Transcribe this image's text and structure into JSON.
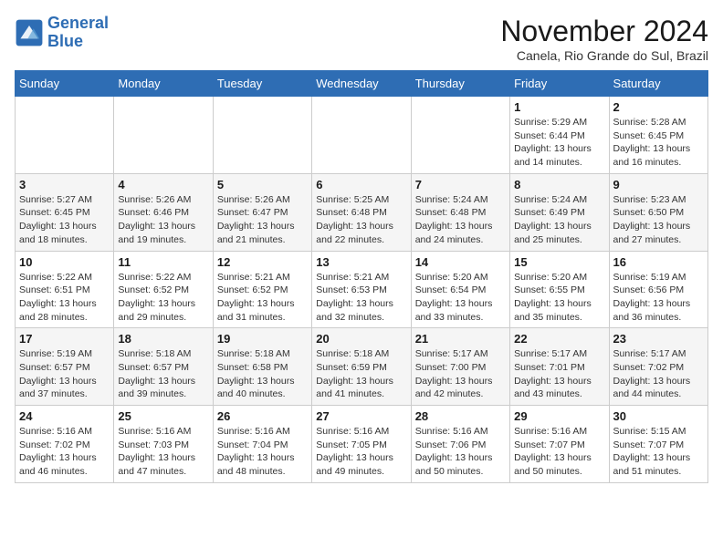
{
  "logo": {
    "line1": "General",
    "line2": "Blue"
  },
  "title": "November 2024",
  "location": "Canela, Rio Grande do Sul, Brazil",
  "days_header": [
    "Sunday",
    "Monday",
    "Tuesday",
    "Wednesday",
    "Thursday",
    "Friday",
    "Saturday"
  ],
  "weeks": [
    [
      {
        "day": "",
        "text": ""
      },
      {
        "day": "",
        "text": ""
      },
      {
        "day": "",
        "text": ""
      },
      {
        "day": "",
        "text": ""
      },
      {
        "day": "",
        "text": ""
      },
      {
        "day": "1",
        "text": "Sunrise: 5:29 AM\nSunset: 6:44 PM\nDaylight: 13 hours and 14 minutes."
      },
      {
        "day": "2",
        "text": "Sunrise: 5:28 AM\nSunset: 6:45 PM\nDaylight: 13 hours and 16 minutes."
      }
    ],
    [
      {
        "day": "3",
        "text": "Sunrise: 5:27 AM\nSunset: 6:45 PM\nDaylight: 13 hours and 18 minutes."
      },
      {
        "day": "4",
        "text": "Sunrise: 5:26 AM\nSunset: 6:46 PM\nDaylight: 13 hours and 19 minutes."
      },
      {
        "day": "5",
        "text": "Sunrise: 5:26 AM\nSunset: 6:47 PM\nDaylight: 13 hours and 21 minutes."
      },
      {
        "day": "6",
        "text": "Sunrise: 5:25 AM\nSunset: 6:48 PM\nDaylight: 13 hours and 22 minutes."
      },
      {
        "day": "7",
        "text": "Sunrise: 5:24 AM\nSunset: 6:48 PM\nDaylight: 13 hours and 24 minutes."
      },
      {
        "day": "8",
        "text": "Sunrise: 5:24 AM\nSunset: 6:49 PM\nDaylight: 13 hours and 25 minutes."
      },
      {
        "day": "9",
        "text": "Sunrise: 5:23 AM\nSunset: 6:50 PM\nDaylight: 13 hours and 27 minutes."
      }
    ],
    [
      {
        "day": "10",
        "text": "Sunrise: 5:22 AM\nSunset: 6:51 PM\nDaylight: 13 hours and 28 minutes."
      },
      {
        "day": "11",
        "text": "Sunrise: 5:22 AM\nSunset: 6:52 PM\nDaylight: 13 hours and 29 minutes."
      },
      {
        "day": "12",
        "text": "Sunrise: 5:21 AM\nSunset: 6:52 PM\nDaylight: 13 hours and 31 minutes."
      },
      {
        "day": "13",
        "text": "Sunrise: 5:21 AM\nSunset: 6:53 PM\nDaylight: 13 hours and 32 minutes."
      },
      {
        "day": "14",
        "text": "Sunrise: 5:20 AM\nSunset: 6:54 PM\nDaylight: 13 hours and 33 minutes."
      },
      {
        "day": "15",
        "text": "Sunrise: 5:20 AM\nSunset: 6:55 PM\nDaylight: 13 hours and 35 minutes."
      },
      {
        "day": "16",
        "text": "Sunrise: 5:19 AM\nSunset: 6:56 PM\nDaylight: 13 hours and 36 minutes."
      }
    ],
    [
      {
        "day": "17",
        "text": "Sunrise: 5:19 AM\nSunset: 6:57 PM\nDaylight: 13 hours and 37 minutes."
      },
      {
        "day": "18",
        "text": "Sunrise: 5:18 AM\nSunset: 6:57 PM\nDaylight: 13 hours and 39 minutes."
      },
      {
        "day": "19",
        "text": "Sunrise: 5:18 AM\nSunset: 6:58 PM\nDaylight: 13 hours and 40 minutes."
      },
      {
        "day": "20",
        "text": "Sunrise: 5:18 AM\nSunset: 6:59 PM\nDaylight: 13 hours and 41 minutes."
      },
      {
        "day": "21",
        "text": "Sunrise: 5:17 AM\nSunset: 7:00 PM\nDaylight: 13 hours and 42 minutes."
      },
      {
        "day": "22",
        "text": "Sunrise: 5:17 AM\nSunset: 7:01 PM\nDaylight: 13 hours and 43 minutes."
      },
      {
        "day": "23",
        "text": "Sunrise: 5:17 AM\nSunset: 7:02 PM\nDaylight: 13 hours and 44 minutes."
      }
    ],
    [
      {
        "day": "24",
        "text": "Sunrise: 5:16 AM\nSunset: 7:02 PM\nDaylight: 13 hours and 46 minutes."
      },
      {
        "day": "25",
        "text": "Sunrise: 5:16 AM\nSunset: 7:03 PM\nDaylight: 13 hours and 47 minutes."
      },
      {
        "day": "26",
        "text": "Sunrise: 5:16 AM\nSunset: 7:04 PM\nDaylight: 13 hours and 48 minutes."
      },
      {
        "day": "27",
        "text": "Sunrise: 5:16 AM\nSunset: 7:05 PM\nDaylight: 13 hours and 49 minutes."
      },
      {
        "day": "28",
        "text": "Sunrise: 5:16 AM\nSunset: 7:06 PM\nDaylight: 13 hours and 50 minutes."
      },
      {
        "day": "29",
        "text": "Sunrise: 5:16 AM\nSunset: 7:07 PM\nDaylight: 13 hours and 50 minutes."
      },
      {
        "day": "30",
        "text": "Sunrise: 5:15 AM\nSunset: 7:07 PM\nDaylight: 13 hours and 51 minutes."
      }
    ]
  ]
}
